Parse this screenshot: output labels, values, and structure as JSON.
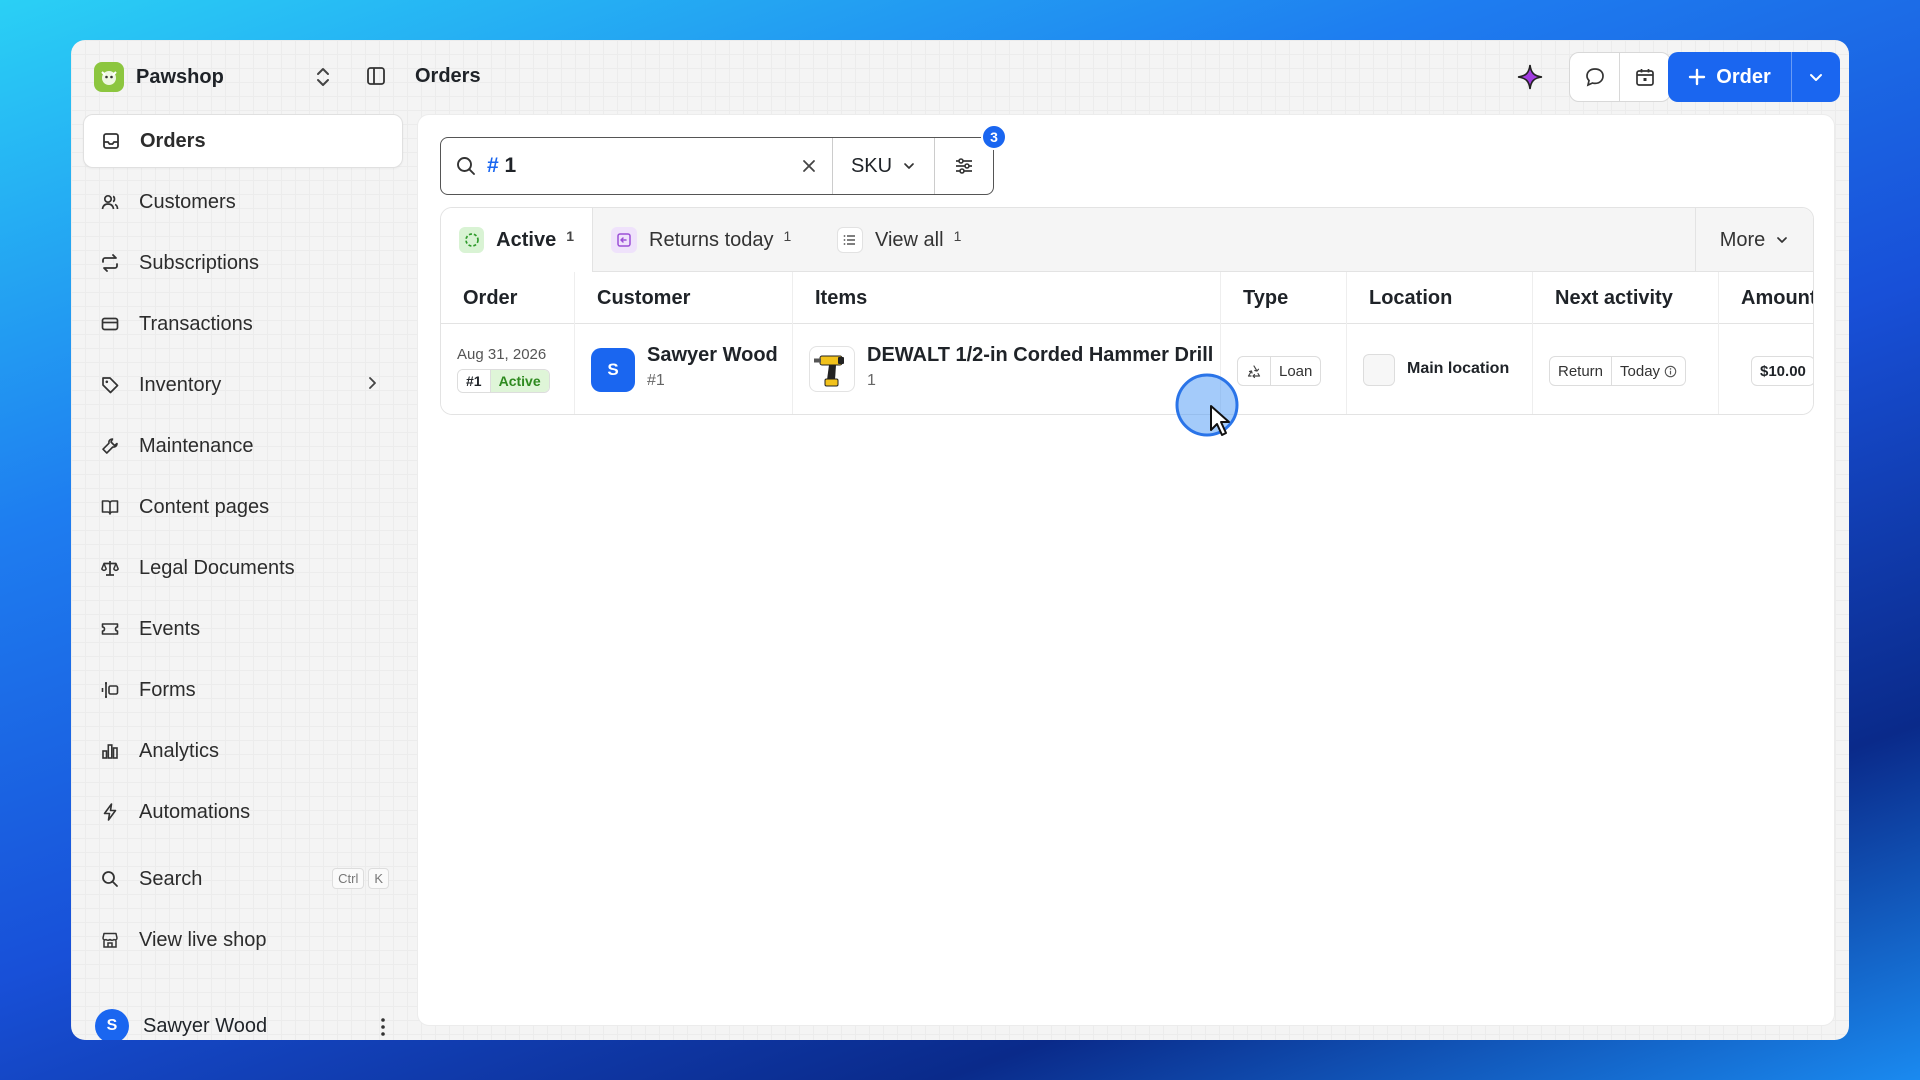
{
  "app": {
    "name": "Pawshop",
    "page_title": "Orders"
  },
  "header": {
    "order_button_label": "Order"
  },
  "sidebar": {
    "items": [
      {
        "label": "Orders",
        "icon": "inbox-icon"
      },
      {
        "label": "Customers",
        "icon": "users-icon"
      },
      {
        "label": "Subscriptions",
        "icon": "repeat-icon"
      },
      {
        "label": "Transactions",
        "icon": "card-icon"
      },
      {
        "label": "Inventory",
        "icon": "tag-icon"
      },
      {
        "label": "Maintenance",
        "icon": "wrench-icon"
      },
      {
        "label": "Content pages",
        "icon": "book-icon"
      },
      {
        "label": "Legal Documents",
        "icon": "scale-icon"
      },
      {
        "label": "Events",
        "icon": "ticket-icon"
      },
      {
        "label": "Forms",
        "icon": "form-icon"
      },
      {
        "label": "Analytics",
        "icon": "bar-chart-icon"
      },
      {
        "label": "Automations",
        "icon": "bolt-icon"
      }
    ],
    "search_label": "Search",
    "search_kbd": [
      "Ctrl",
      "K"
    ],
    "live_shop_label": "View live shop",
    "user": {
      "initial": "S",
      "name": "Sawyer Wood"
    }
  },
  "search": {
    "prefix": "#",
    "value": "1",
    "scope": "SKU",
    "filter_count": "3"
  },
  "views": [
    {
      "label": "Active",
      "count": "1"
    },
    {
      "label": "Returns today",
      "count": "1"
    },
    {
      "label": "View all",
      "count": "1"
    }
  ],
  "more_label": "More",
  "table": {
    "columns": [
      "Order",
      "Customer",
      "Items",
      "Type",
      "Location",
      "Next activity",
      "Amount"
    ],
    "rows": [
      {
        "date": "Aug 31, 2026",
        "order_number": "#1",
        "status": "Active",
        "customer_initial": "S",
        "customer_name": "Sawyer Wood",
        "customer_sub": "#1",
        "item_name": "DEWALT 1/2-in Corded Hammer Drill",
        "item_qty": "1",
        "type": "Loan",
        "location": "Main location",
        "next_activity": "Return",
        "next_when": "Today",
        "amount": "$10.00"
      }
    ]
  },
  "colors": {
    "accent": "#1a66f0",
    "active_green": "#2e8a1f",
    "brand_logo": "#8cc63f"
  }
}
